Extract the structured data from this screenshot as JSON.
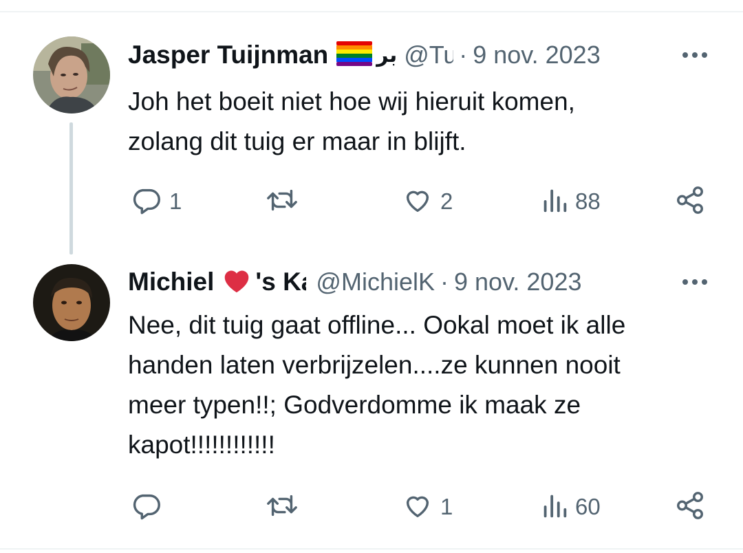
{
  "tweets": [
    {
      "name": "Jasper Tuijnman",
      "name_suffix": "بر",
      "handle": "@Tuijnman",
      "separator": "·",
      "date": "9 nov. 2023",
      "lines": [
        "Joh het boeit niet hoe wij hieruit komen,",
        "zolang dit tuig er maar in blijft."
      ],
      "replies": "1",
      "retweets": "",
      "likes": "2",
      "views": "88"
    },
    {
      "name": "Michiel",
      "name_suffix": "'s Kapot",
      "handle": "@MichielK",
      "separator": "·",
      "date": "9 nov. 2023",
      "lines": [
        "Nee, dit tuig gaat offline... Ookal moet ik alle",
        "handen laten verbrijzelen....ze kunnen nooit",
        "meer typen!!; Godverdomme ik maak ze",
        "kapot!!!!!!!!!!!!"
      ],
      "replies": "",
      "retweets": "",
      "likes": "1",
      "views": "60"
    }
  ],
  "icons": {
    "reply": "reply-icon",
    "retweet": "retweet-icon",
    "like": "heart-icon",
    "views": "views-icon",
    "share": "share-icon",
    "more": "more-icon",
    "flag": "rainbow-flag-icon",
    "heart_emoji": "red-heart-icon"
  },
  "colors": {
    "text": "#0f1419",
    "secondary": "#536471",
    "thread_line": "#cfd9de",
    "divider": "#eff3f4"
  }
}
